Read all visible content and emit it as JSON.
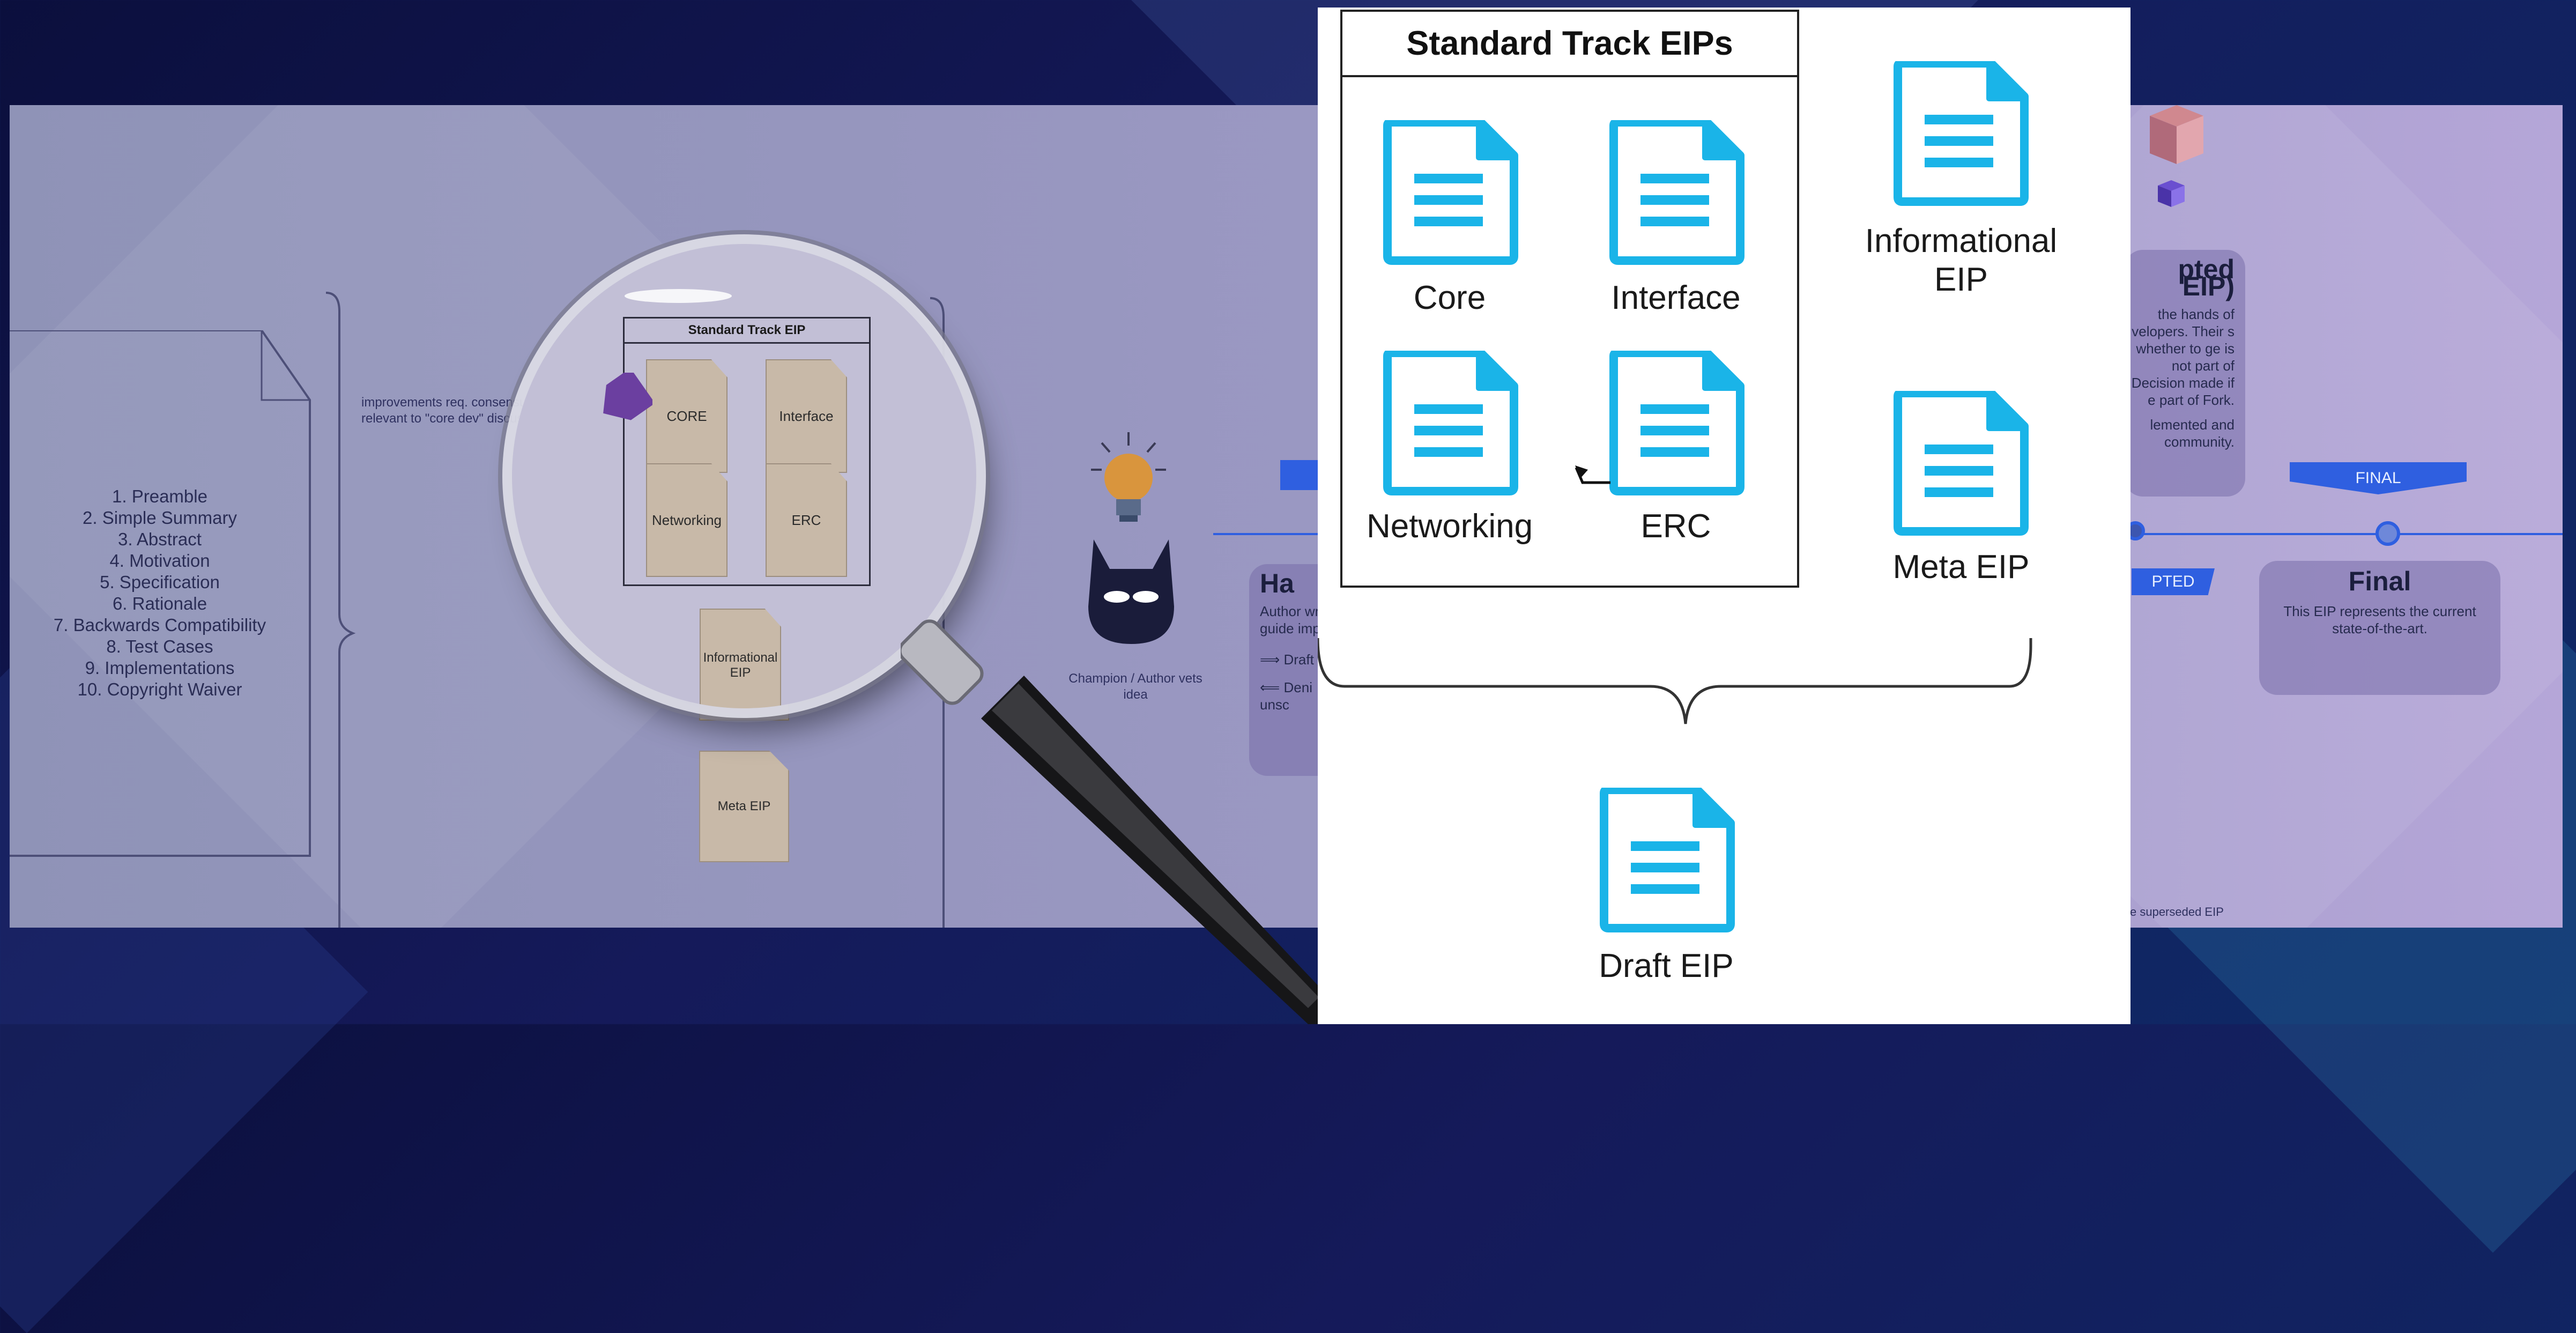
{
  "background_diagram": {
    "eip_sections": [
      "1. Preamble",
      "2. Simple Summary",
      "3. Abstract",
      "4. Motivation",
      "5. Specification",
      "6. Rationale",
      "7. Backwards Compatibility",
      "8. Test Cases",
      "9. Implementations",
      "10. Copyright Waiver"
    ],
    "core_note": "improvements req. consensus fork or relevant to \"core dev\" discussions",
    "standard_track_title": "Standard Track EIP",
    "lens_docs": [
      "CORE",
      "Interface",
      "Networking",
      "ERC"
    ],
    "informational_doc": "Informational EIP",
    "meta_doc": "Meta EIP",
    "champion_caption": "Champion / Author vets idea",
    "hash_card": {
      "title": "Ha",
      "body": "Author wr guide imple",
      "draft_arrow": "⟹ Draft",
      "denied_arrow": "⟸ Deni unsc"
    },
    "accepted_card": {
      "title": "pted EIP)",
      "body": "the hands of velopers. Their s whether to ge is not part of Decision made if e part of Fork.",
      "body2": "lemented and community."
    },
    "final_ribbon": "FINAL",
    "accepted_ribbon": "PTED",
    "final_card": {
      "title": "Final",
      "body": "This EIP represents the current state-of-the-art."
    },
    "superseded_note": "e superseded EIP"
  },
  "zoom_panel": {
    "box_title": "Standard Track EIPs",
    "standard_docs": [
      "Core",
      "Interface",
      "Networking",
      "ERC"
    ],
    "informational": "Informational EIP",
    "meta": "Meta EIP",
    "draft": "Draft EIP"
  },
  "colors": {
    "doc_icon": "#1ab4e8",
    "ribbon": "#2f5fe0",
    "background": "#0b0f3d"
  }
}
